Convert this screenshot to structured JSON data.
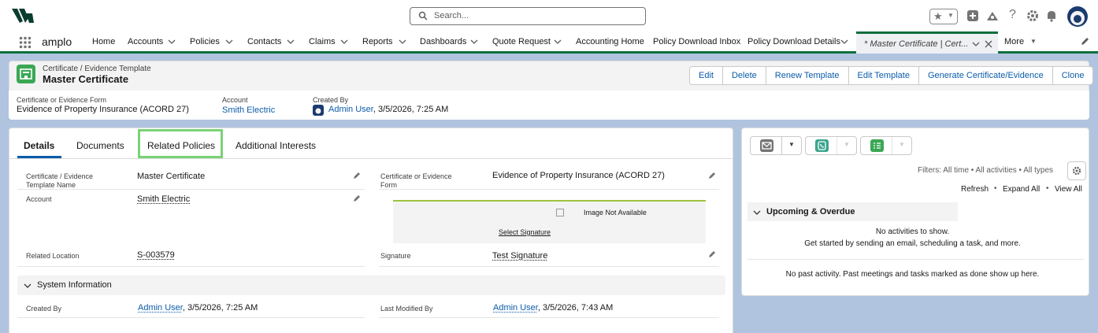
{
  "header": {
    "search_placeholder": "Search...",
    "colors": {
      "brand": "#0a6e3c",
      "link": "#0b5cab",
      "success": "#3ba755"
    }
  },
  "nav": {
    "app_name": "amplo",
    "items": [
      "Home",
      "Accounts",
      "Policies",
      "Contacts",
      "Claims",
      "Reports",
      "Dashboards",
      "Quote Request",
      "Accounting Home",
      "Policy Download Inbox",
      "Policy Download Details"
    ],
    "active_tab": "* Master Certificate | Cert...",
    "more": "More"
  },
  "record": {
    "object_type": "Certificate / Evidence Template",
    "name": "Master Certificate",
    "actions": [
      "Edit",
      "Delete",
      "Renew Template",
      "Edit Template",
      "Generate Certificate/Evidence",
      "Clone"
    ],
    "highlights": {
      "form_label": "Certificate or Evidence Form",
      "form_value": "Evidence of Property Insurance (ACORD 27)",
      "account_label": "Account",
      "account_value": "Smith Electric",
      "created_label": "Created By",
      "created_user": "Admin User",
      "created_date": ", 3/5/2026, 7:25 AM"
    }
  },
  "tabs": [
    "Details",
    "Documents",
    "Related Policies",
    "Additional Interests"
  ],
  "details": {
    "template_name_label_1": "Certificate / Evidence",
    "template_name_label_2": "Template Name",
    "template_name_value": "Master Certificate",
    "form_label_1": "Certificate or Evidence",
    "form_label_2": "Form",
    "form_value": "Evidence of Property Insurance (ACORD 27)",
    "account_label": "Account",
    "account_value": "Smith Electric",
    "image_alt": "Image Not Available",
    "select_signature": "Select Signature",
    "location_label": "Related Location",
    "location_value": "S-003579",
    "signature_label": "Signature",
    "signature_value": "Test Signature",
    "system_info": "System Information",
    "created_by_label": "Created By",
    "created_by_user": "Admin User",
    "created_by_date": ", 3/5/2026, 7:25 AM",
    "modified_by_label": "Last Modified By",
    "modified_by_user": "Admin User",
    "modified_by_date": ", 3/5/2026, 7:43 AM"
  },
  "activity": {
    "filters": "Filters: All time • All activities • All types",
    "refresh": "Refresh",
    "expand_all": "Expand All",
    "view_all": "View All",
    "upcoming": "Upcoming & Overdue",
    "no_activities": "No activities to show.",
    "get_started": "Get started by sending an email, scheduling a task, and more.",
    "no_past": "No past activity. Past meetings and tasks marked as done show up here."
  }
}
